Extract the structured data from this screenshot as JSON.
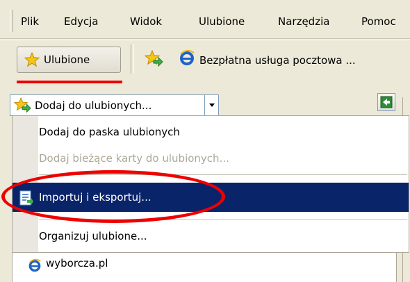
{
  "menu": {
    "items": [
      "Plik",
      "Edycja",
      "Widok",
      "Ulubione",
      "Narzędzia",
      "Pomoc"
    ]
  },
  "links_bar": {
    "favorites_button": "Ulubione",
    "mail_link": "Bezpłatna usługa pocztowa ..."
  },
  "favorites_pane": {
    "add_button": "Dodaj do ulubionych...",
    "dropdown_items": [
      {
        "label": "Dodaj do paska ulubionych",
        "enabled": true
      },
      {
        "label": "Dodaj bieżące karty do ulubionych...",
        "enabled": false
      },
      {
        "label": "Importuj i eksportuj...",
        "enabled": true,
        "highlighted": true
      },
      {
        "label": "Organizuj ulubione...",
        "enabled": true
      }
    ],
    "list": [
      {
        "label": "wyborcza.pl",
        "icon": "ie-icon"
      }
    ]
  },
  "colors": {
    "annotation_red": "#ee0000",
    "highlight": "#0a246a",
    "chrome": "#ece9d8"
  }
}
